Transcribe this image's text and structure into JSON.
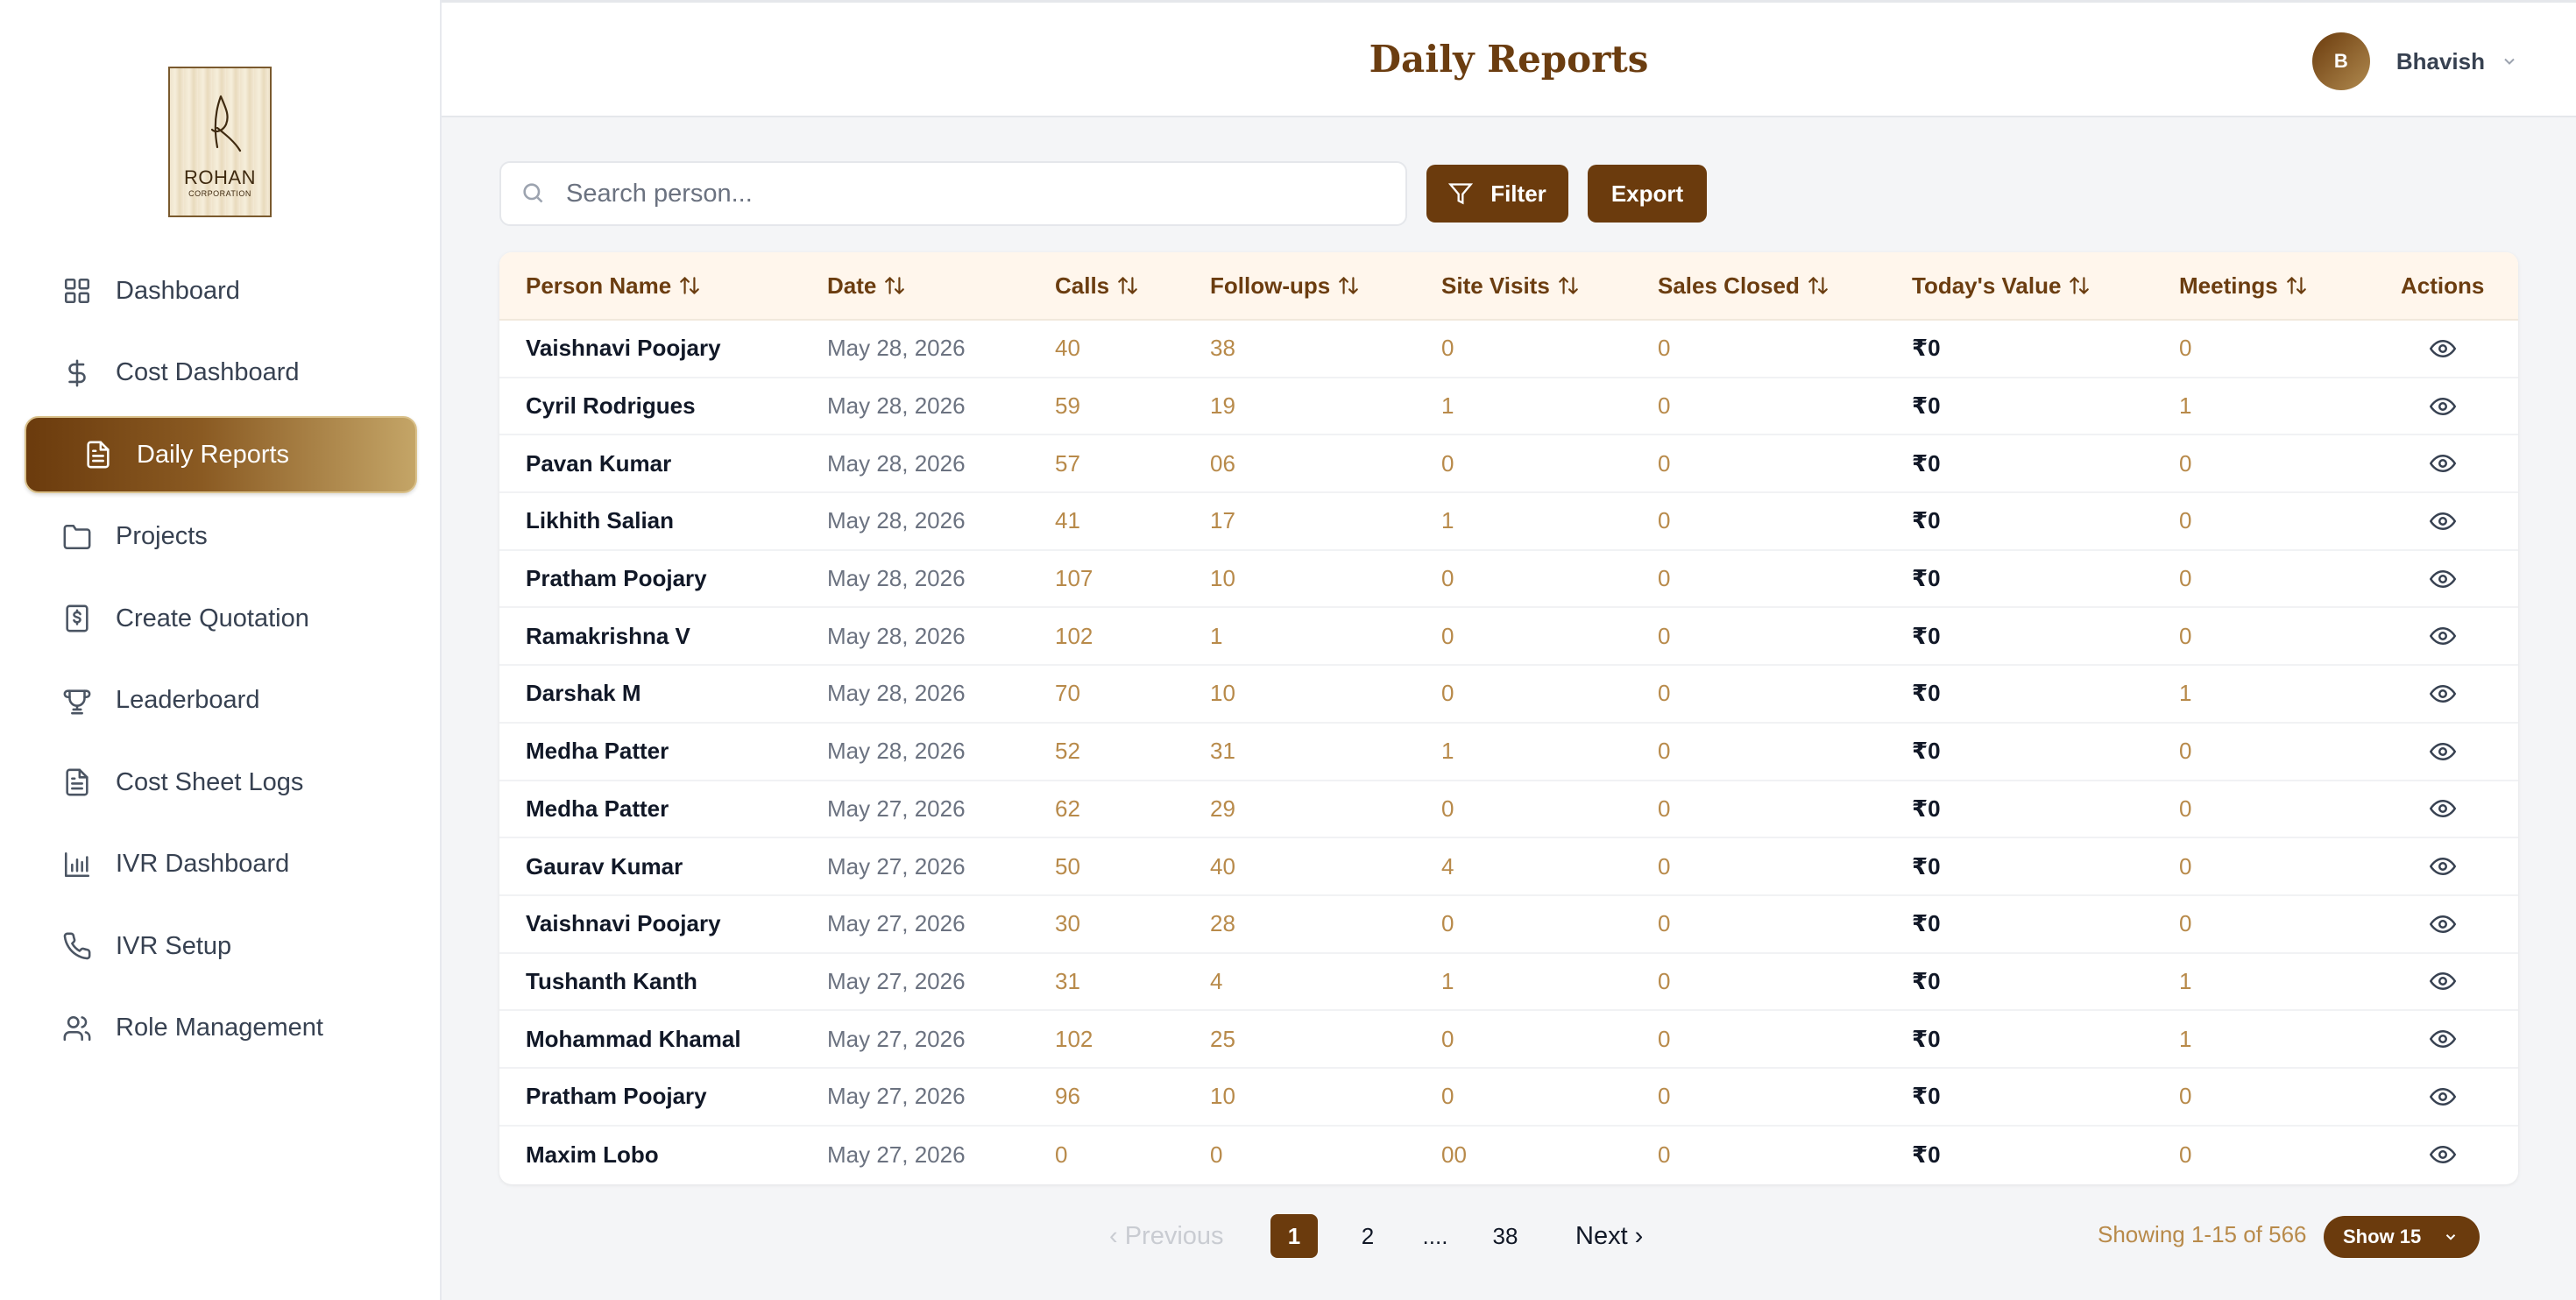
{
  "logo": {
    "name": "ROHAN",
    "sub": "CORPORATION"
  },
  "sidebar": {
    "items": [
      {
        "label": "Dashboard",
        "icon": "grid-icon"
      },
      {
        "label": "Cost Dashboard",
        "icon": "dollar-icon"
      },
      {
        "label": "Daily Reports",
        "icon": "document-icon",
        "active": true
      },
      {
        "label": "Projects",
        "icon": "folder-icon"
      },
      {
        "label": "Create Quotation",
        "icon": "receipt-icon"
      },
      {
        "label": "Leaderboard",
        "icon": "trophy-icon"
      },
      {
        "label": "Cost Sheet Logs",
        "icon": "document-icon"
      },
      {
        "label": "IVR Dashboard",
        "icon": "bar-chart-icon"
      },
      {
        "label": "IVR Setup",
        "icon": "phone-icon"
      },
      {
        "label": "Role Management",
        "icon": "users-icon"
      }
    ]
  },
  "header": {
    "title": "Daily Reports",
    "user_initial": "B",
    "user_name": "Bhavish"
  },
  "toolbar": {
    "search_placeholder": "Search person...",
    "filter_label": "Filter",
    "export_label": "Export"
  },
  "table": {
    "columns": [
      "Person Name",
      "Date",
      "Calls",
      "Follow-ups",
      "Site Visits",
      "Sales Closed",
      "Today's Value",
      "Meetings",
      "Actions"
    ],
    "rows": [
      [
        "Vaishnavi Poojary",
        "May 28, 2026",
        "40",
        "38",
        "0",
        "0",
        "₹0",
        "0"
      ],
      [
        "Cyril Rodrigues",
        "May 28, 2026",
        "59",
        "19",
        "1",
        "0",
        "₹0",
        "1"
      ],
      [
        "Pavan Kumar",
        "May 28, 2026",
        "57",
        "06",
        "0",
        "0",
        "₹0",
        "0"
      ],
      [
        "Likhith Salian",
        "May 28, 2026",
        "41",
        "17",
        "1",
        "0",
        "₹0",
        "0"
      ],
      [
        "Pratham Poojary",
        "May 28, 2026",
        "107",
        "10",
        "0",
        "0",
        "₹0",
        "0"
      ],
      [
        "Ramakrishna V",
        "May 28, 2026",
        "102",
        "1",
        "0",
        "0",
        "₹0",
        "0"
      ],
      [
        "Darshak M",
        "May 28, 2026",
        "70",
        "10",
        "0",
        "0",
        "₹0",
        "1"
      ],
      [
        "Medha Patter",
        "May 28, 2026",
        "52",
        "31",
        "1",
        "0",
        "₹0",
        "0"
      ],
      [
        "Medha Patter",
        "May 27, 2026",
        "62",
        "29",
        "0",
        "0",
        "₹0",
        "0"
      ],
      [
        "Gaurav Kumar",
        "May 27, 2026",
        "50",
        "40",
        "4",
        "0",
        "₹0",
        "0"
      ],
      [
        "Vaishnavi Poojary",
        "May 27, 2026",
        "30",
        "28",
        "0",
        "0",
        "₹0",
        "0"
      ],
      [
        "Tushanth Kanth",
        "May 27, 2026",
        "31",
        "4",
        "1",
        "0",
        "₹0",
        "1"
      ],
      [
        "Mohammad Khamal",
        "May 27, 2026",
        "102",
        "25",
        "0",
        "0",
        "₹0",
        "1"
      ],
      [
        "Pratham Poojary",
        "May 27, 2026",
        "96",
        "10",
        "0",
        "0",
        "₹0",
        "0"
      ],
      [
        "Maxim Lobo",
        "May 27, 2026",
        "0",
        "0",
        "00",
        "0",
        "₹0",
        "0"
      ]
    ]
  },
  "pagination": {
    "previous_label": "‹ Previous",
    "next_label": "Next ›",
    "pages": [
      "1",
      "2",
      "....",
      "38"
    ],
    "current": "1",
    "showing": "Showing 1-15 of 566",
    "show_label": "Show 15"
  }
}
